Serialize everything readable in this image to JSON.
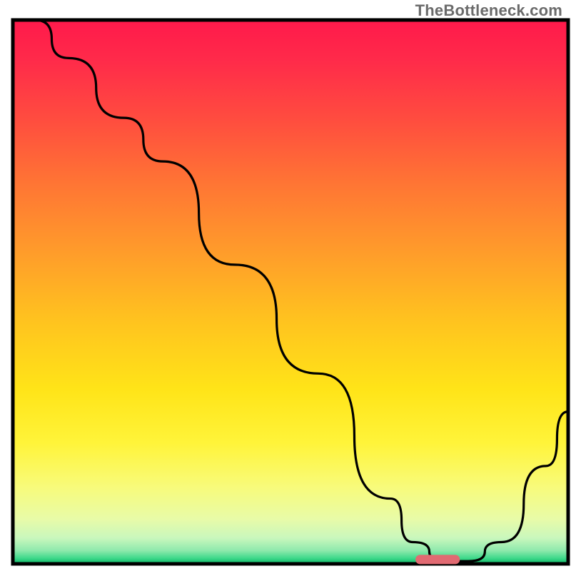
{
  "watermark": "TheBottleneck.com",
  "chart_data": {
    "type": "line",
    "title": "",
    "xlabel": "",
    "ylabel": "",
    "xlim": [
      0,
      100
    ],
    "ylim": [
      0,
      100
    ],
    "x": [
      4,
      10,
      20,
      27,
      40,
      55,
      68,
      72,
      78,
      82,
      88,
      96,
      100
    ],
    "values": [
      100,
      93,
      82,
      74,
      55,
      35,
      12,
      4,
      0.5,
      0.5,
      4,
      18,
      28
    ],
    "marker": {
      "x_start": 72.5,
      "x_end": 80.5,
      "y": 0.8,
      "color": "#e16a72"
    },
    "background_gradient_stops": [
      {
        "offset": 0.0,
        "color": "#ff1a4b"
      },
      {
        "offset": 0.07,
        "color": "#ff2a4a"
      },
      {
        "offset": 0.18,
        "color": "#ff4c3f"
      },
      {
        "offset": 0.3,
        "color": "#ff7534"
      },
      {
        "offset": 0.42,
        "color": "#ff9a2b"
      },
      {
        "offset": 0.55,
        "color": "#ffc21f"
      },
      {
        "offset": 0.68,
        "color": "#ffe418"
      },
      {
        "offset": 0.78,
        "color": "#fff43a"
      },
      {
        "offset": 0.86,
        "color": "#f8fb7a"
      },
      {
        "offset": 0.92,
        "color": "#e8fba8"
      },
      {
        "offset": 0.955,
        "color": "#c9f7bd"
      },
      {
        "offset": 0.978,
        "color": "#8ee9ac"
      },
      {
        "offset": 0.992,
        "color": "#3fd98b"
      },
      {
        "offset": 1.0,
        "color": "#17c06f"
      }
    ],
    "border_color": "#000000",
    "line_color": "#000000"
  }
}
